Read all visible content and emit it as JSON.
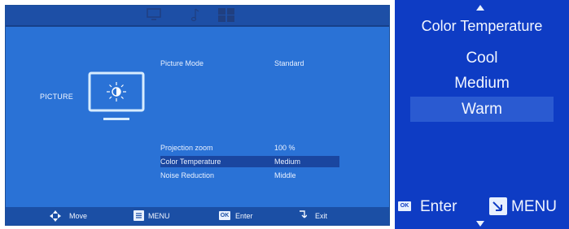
{
  "left_panel": {
    "tabs": [
      {
        "icon": "tv-icon"
      },
      {
        "icon": "music-note-icon"
      },
      {
        "icon": "picture-grid-icon"
      }
    ],
    "section_title": "PICTURE",
    "menu": [
      {
        "label": "Picture Mode",
        "value": "Standard"
      },
      {
        "label": "Projection zoom",
        "value": "100 %"
      },
      {
        "label": "Color Temperature",
        "value": "Medium",
        "selected": true
      },
      {
        "label": "Noise Reduction",
        "value": "Middle"
      }
    ],
    "footer": {
      "move_label": "Move",
      "menu_label": "MENU",
      "ok_badge": "OK",
      "enter_label": "Enter",
      "exit_label": "Exit"
    }
  },
  "right_panel": {
    "title": "Color Temperature",
    "options": [
      "Cool",
      "Medium",
      "Warm"
    ],
    "selected_option": "Warm",
    "footer": {
      "ok_badge": "OK",
      "enter_label": "Enter",
      "menu_label": "MENU"
    }
  },
  "colors": {
    "panel_bg": "#2a72d6",
    "bar_bg": "#1b4fa5",
    "highlight": "#1a46a0",
    "popup_bg": "#0e3cc4",
    "popup_highlight": "#2a5ad1"
  }
}
